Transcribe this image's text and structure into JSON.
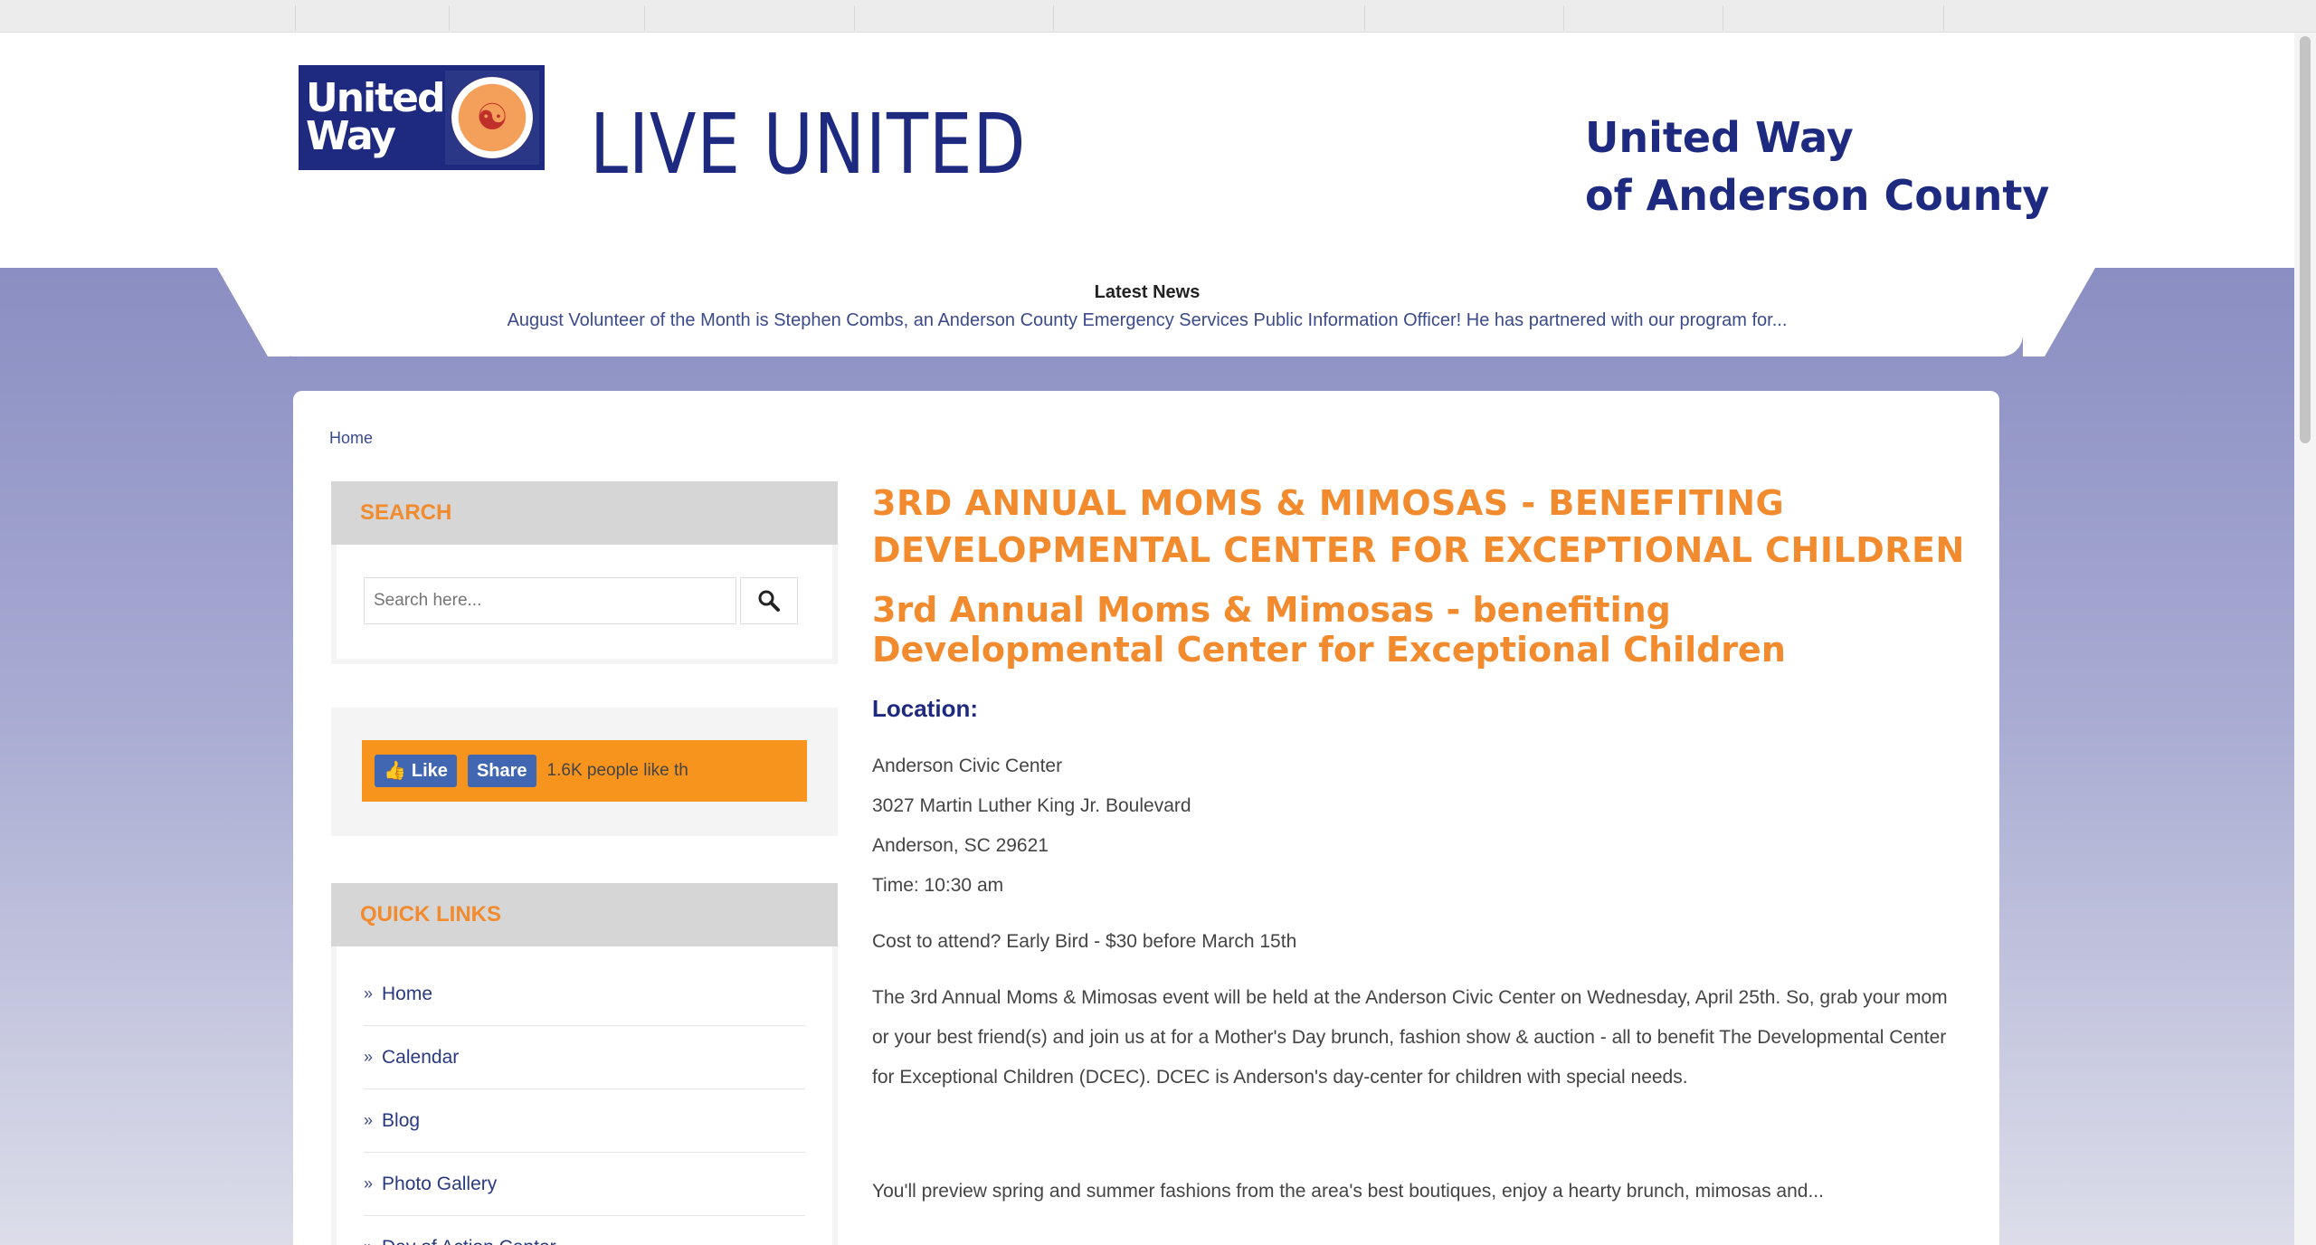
{
  "header": {
    "logo_text": "United Way",
    "tagline": "LIVE UNITED",
    "org_line1": "United Way",
    "org_line2": "of Anderson County"
  },
  "news": {
    "title": "Latest News",
    "text": "August Volunteer of the Month is Stephen Combs, an Anderson County Emergency Services Public Information Officer! He has partnered with our program for..."
  },
  "breadcrumb": "Home",
  "search": {
    "title": "SEARCH",
    "placeholder": "Search here..."
  },
  "facebook": {
    "like_label": "Like",
    "share_label": "Share",
    "count_text": "1.6K people like th"
  },
  "quick_links": {
    "title": "QUICK LINKS",
    "items": [
      {
        "label": "Home"
      },
      {
        "label": "Calendar"
      },
      {
        "label": "Blog"
      },
      {
        "label": "Photo Gallery"
      },
      {
        "label": "Day of Action Center"
      }
    ]
  },
  "article": {
    "title_upper": "3RD ANNUAL MOMS & MIMOSAS - BENEFITING DEVELOPMENTAL CENTER FOR EXCEPTIONAL CHILDREN",
    "title_mixed": "3rd Annual Moms & Mimosas - benefiting Developmental Center for Exceptional Children",
    "location_label": "Location:",
    "address": [
      "Anderson Civic Center",
      "3027 Martin Luther King Jr. Boulevard",
      "Anderson, SC 29621",
      "Time: 10:30 am"
    ],
    "cost": "Cost to attend? Early Bird - $30 before March 15th",
    "paragraph1": "The 3rd Annual Moms & Mimosas event will be held at the Anderson Civic Center on Wednesday, April 25th.  So, grab your mom or your best friend(s) and join us at  for a Mother's Day brunch, fashion show & auction - all to benefit The Developmental Center for Exceptional Children (DCEC). DCEC is Anderson's day-center for children with special needs.",
    "paragraph2": "You'll preview spring and summer fashions from the area's best boutiques, enjoy a hearty brunch, mimosas and..."
  },
  "colors": {
    "brand_navy": "#1d2a80",
    "accent_orange": "#f28a2e",
    "band_top": "#8a8ec2",
    "facebook_blue": "#4267b2"
  }
}
